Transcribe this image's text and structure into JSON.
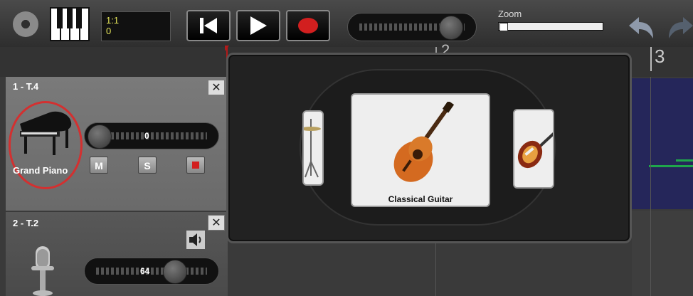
{
  "toolbar": {
    "position_line1": "1:1",
    "position_line2": "0",
    "zoom_label": "Zoom",
    "zoom_level": 0.02
  },
  "timeline": {
    "marker_2": "2",
    "marker_3": "3"
  },
  "tracks": [
    {
      "name": "1 - T.4",
      "instrument": "Grand Piano",
      "volume_value": "0",
      "mute_label": "M",
      "solo_label": "S"
    },
    {
      "name": "2 - T.2",
      "volume_value": "64"
    }
  ],
  "instrument_picker": {
    "selected_label": "Classical Guitar"
  },
  "colors": {
    "record": "#d21f1f",
    "selection_circle": "#d33030",
    "midi_note": "#1fa64b",
    "track_area": "#25265a"
  },
  "icons": [
    "gear-icon",
    "piano-keys-icon",
    "rewind-icon",
    "play-icon",
    "record-icon",
    "undo-icon",
    "redo-icon",
    "close-icon",
    "speaker-icon",
    "grand-piano-icon",
    "microphone-icon",
    "drum-kit-icon",
    "classical-guitar-icon",
    "electric-bass-icon"
  ]
}
